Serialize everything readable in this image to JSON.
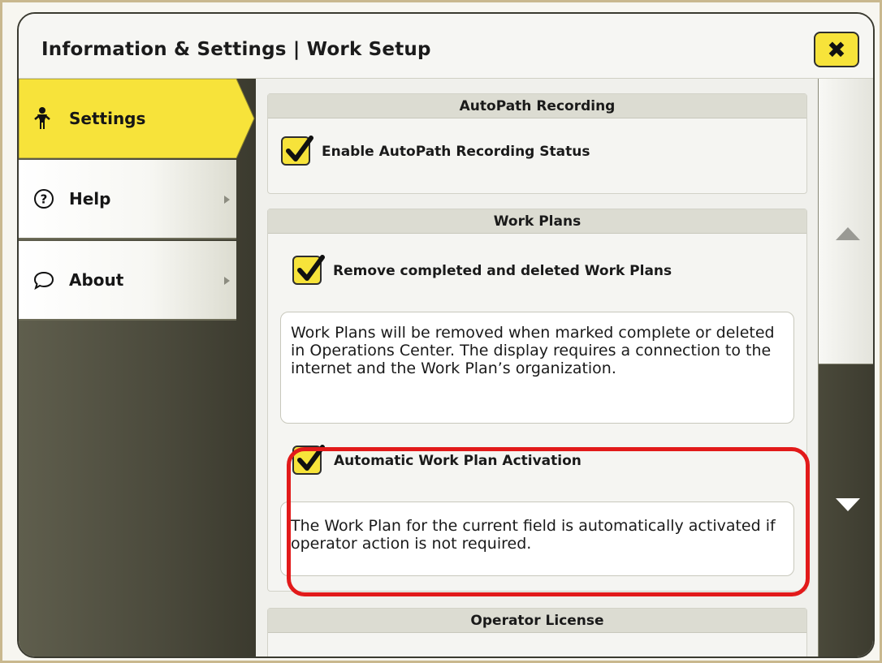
{
  "window": {
    "title": "Information & Settings | Work Setup",
    "close_icon": "close-icon"
  },
  "sidebar": {
    "items": [
      {
        "label": "Settings",
        "icon": "person-icon",
        "active": true
      },
      {
        "label": "Help",
        "icon": "question-circle-icon",
        "active": false
      },
      {
        "label": "About",
        "icon": "speech-bubble-icon",
        "active": false
      }
    ]
  },
  "sections": {
    "autopath": {
      "header": "AutoPath Recording",
      "enable_label": "Enable AutoPath Recording Status",
      "enable_checked": true
    },
    "work_plans": {
      "header": "Work Plans",
      "remove_label": "Remove completed and deleted Work Plans",
      "remove_checked": true,
      "remove_desc": "Work Plans will be removed when marked complete or deleted in Operations Center. The display requires a connection to the internet and the Work Plan’s organization.",
      "activation_label": "Automatic Work Plan Activation",
      "activation_checked": true,
      "activation_desc": "The Work Plan for the current field is automatically activated if operator action is not required."
    },
    "operator_license": {
      "header": "Operator License"
    }
  },
  "colors": {
    "accent_yellow": "#f7e33a",
    "highlight_red": "#e21a1a",
    "sidebar_dark": "#4b4a3c"
  },
  "scrollbar": {
    "up_icon": "triangle-up-icon",
    "down_icon": "triangle-down-icon"
  }
}
